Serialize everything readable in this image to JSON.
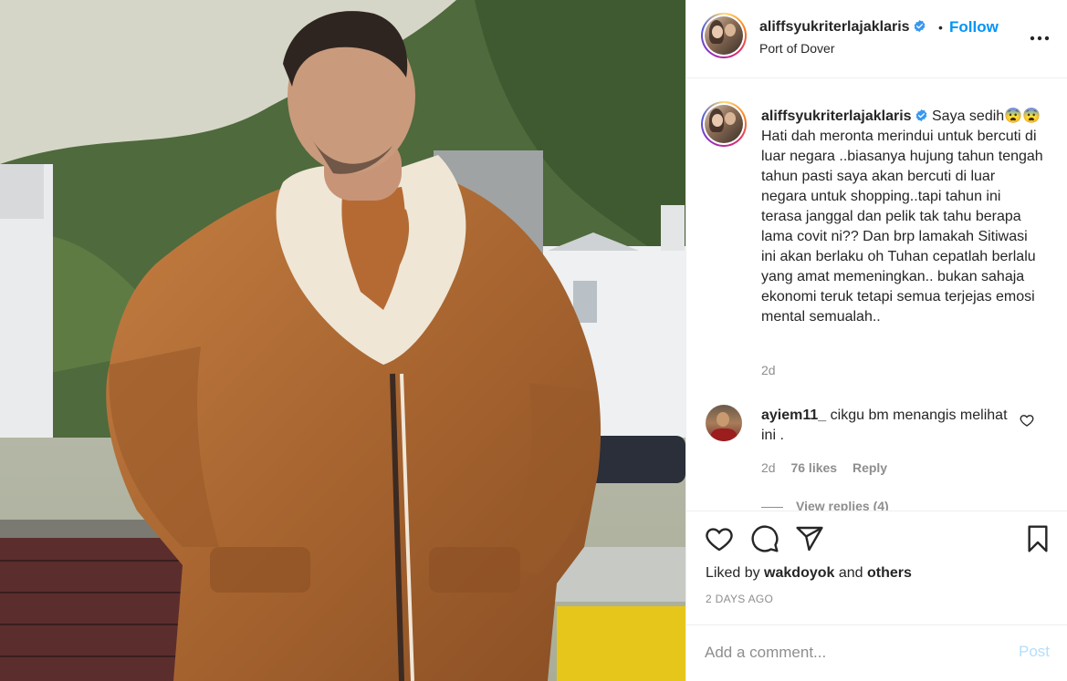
{
  "header": {
    "username": "aliffsyukriterlajaklaris",
    "separator": "•",
    "follow_label": "Follow",
    "location": "Port of Dover"
  },
  "caption": {
    "username": "aliffsyukriterlajaklaris",
    "text": "Saya sedih😨😨Hati dah meronta merindui untuk bercuti di luar negara ..biasanya hujung tahun tengah tahun pasti saya akan bercuti di luar negara untuk shopping..tapi tahun ini terasa janggal dan pelik tak tahu berapa lama covit ni?? Dan brp lamakah Sitiwasi ini akan berlaku oh Tuhan cepatlah berlalu yang amat memeningkan.. bukan sahaja ekonomi teruk tetapi semua terjejas emosi mental semualah..",
    "time": "2d"
  },
  "comment": {
    "username": "ayiem11_",
    "text": "cikgu bm menangis melihat ini .",
    "time": "2d",
    "likes": "76 likes",
    "reply": "Reply",
    "view_replies": "View replies (4)"
  },
  "actions": {
    "liked_by_prefix": "Liked by",
    "liked_by_user": "wakdoyok",
    "liked_by_and": "and",
    "liked_by_others": "others",
    "date": "2 DAYS AGO"
  },
  "add_comment": {
    "placeholder": "Add a comment...",
    "post_label": "Post"
  },
  "icons": {
    "header_more": "more-horizontal-icon",
    "verified": "verified-badge-icon",
    "like": "heart-icon",
    "comment": "comment-icon",
    "share": "share-icon",
    "save": "bookmark-icon",
    "comment_like": "small-heart-icon"
  },
  "colors": {
    "accent": "#0095f6",
    "post_disabled": "#b2dffc",
    "secondary_text": "#8e8e8e",
    "primary_text": "#262626"
  }
}
